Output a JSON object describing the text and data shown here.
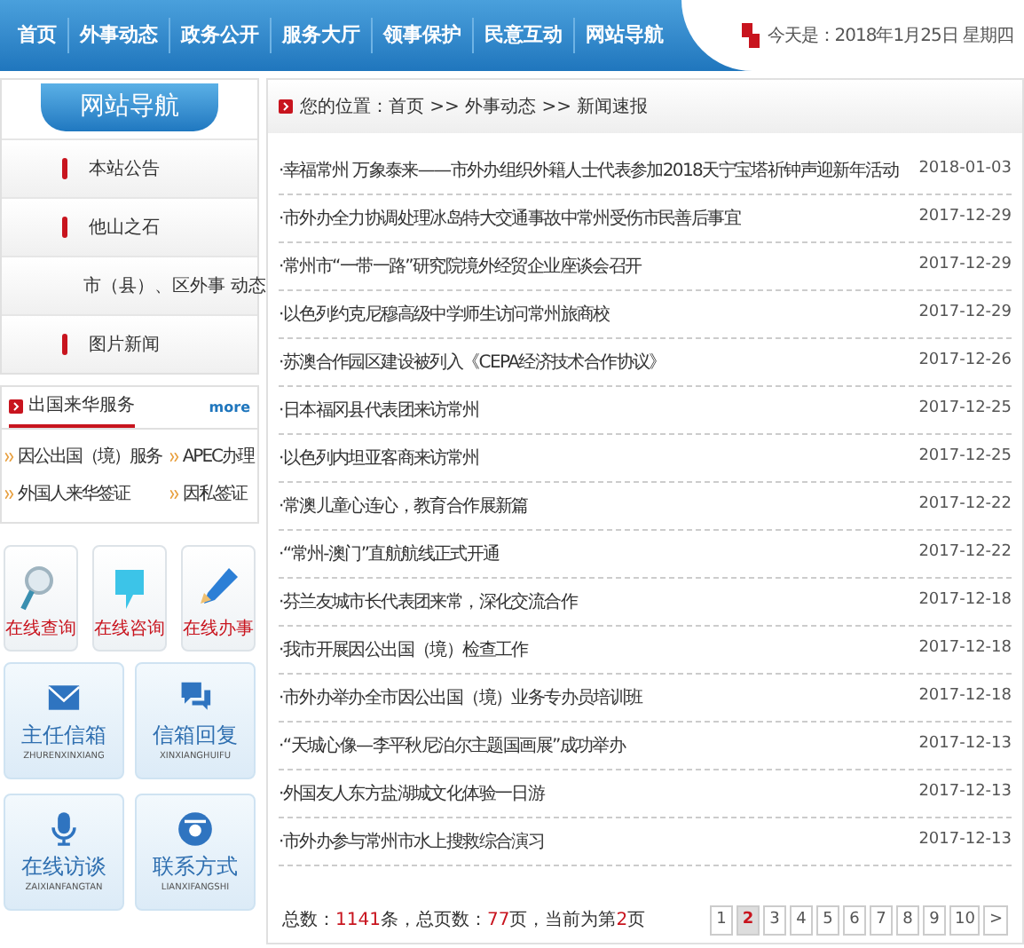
{
  "nav": [
    {
      "label": "首页"
    },
    {
      "label": "外事动态"
    },
    {
      "label": "政务公开"
    },
    {
      "label": "服务大厅"
    },
    {
      "label": "领事保护"
    },
    {
      "label": "民意互动"
    },
    {
      "label": "网站导航"
    }
  ],
  "date": "今天是：2018年1月25日 星期四",
  "sidebar": {
    "title": "网站导航",
    "items": [
      "本站公告",
      "他山之石",
      "市（县）、区外事 动态",
      "图片新闻"
    ]
  },
  "services": {
    "title": "出国来华服务",
    "more": "more",
    "links": [
      "因公出国（境）服务",
      "APEC办理",
      "外国人来华签证",
      "因私签证"
    ]
  },
  "quick": [
    {
      "label": "在线查询",
      "kind": "search"
    },
    {
      "label": "在线咨询",
      "kind": "bubble"
    },
    {
      "label": "在线办事",
      "kind": "pencil"
    }
  ],
  "tiles": [
    {
      "label": "主任信箱",
      "sub": "ZHURENXINXIANG",
      "kind": "mail"
    },
    {
      "label": "信箱回复",
      "sub": "XINXIANGHUIFU",
      "kind": "chat"
    },
    {
      "label": "在线访谈",
      "sub": "ZAIXIANFANGTAN",
      "kind": "mic"
    },
    {
      "label": "联系方式",
      "sub": "LIANXIFANGSHI",
      "kind": "phone"
    }
  ],
  "breadcrumb": "您的位置：首页 >> 外事动态 >> 新闻速报",
  "news": [
    {
      "title": "·幸福常州 万象泰来——市外办组织外籍人士代表参加2018天宁宝塔祈钟声迎新年活动",
      "date": "2018-01-03"
    },
    {
      "title": "·市外办全力协调处理冰岛特大交通事故中常州受伤市民善后事宜",
      "date": "2017-12-29"
    },
    {
      "title": "·常州市“一带一路”研究院境外经贸企业座谈会召开",
      "date": "2017-12-29"
    },
    {
      "title": "·以色列约克尼穆高级中学师生访问常州旅商校",
      "date": "2017-12-29"
    },
    {
      "title": "·苏澳合作园区建设被列入《CEPA经济技术合作协议》",
      "date": "2017-12-26"
    },
    {
      "title": "·日本福冈县代表团来访常州",
      "date": "2017-12-25"
    },
    {
      "title": "·以色列内坦亚客商来访常州",
      "date": "2017-12-25"
    },
    {
      "title": "·常澳儿童心连心，教育合作展新篇",
      "date": "2017-12-22"
    },
    {
      "title": "·“常州-澳门”直航航线正式开通",
      "date": "2017-12-22"
    },
    {
      "title": "·芬兰友城市长代表团来常，深化交流合作",
      "date": "2017-12-18"
    },
    {
      "title": "·我市开展因公出国（境）检查工作",
      "date": "2017-12-18"
    },
    {
      "title": "·市外办举办全市因公出国（境）业务专办员培训班",
      "date": "2017-12-18"
    },
    {
      "title": "·“天城心像—李平秋尼泊尔主题国画展”成功举办",
      "date": "2017-12-13"
    },
    {
      "title": "·外国友人东方盐湖城文化体验一日游",
      "date": "2017-12-13"
    },
    {
      "title": "·市外办参与常州市水上搜救综合演习",
      "date": "2017-12-13"
    }
  ],
  "summary": [
    {
      "text": "总数：",
      "highlight": false
    },
    {
      "text": "1141",
      "highlight": true
    },
    {
      "text": "条，总页数：",
      "highlight": false
    },
    {
      "text": "77",
      "highlight": true
    },
    {
      "text": "页，当前为第",
      "highlight": false
    },
    {
      "text": "2",
      "highlight": true
    },
    {
      "text": "页",
      "highlight": false
    }
  ],
  "pages": [
    {
      "label": "1",
      "selected": false
    },
    {
      "label": "2",
      "selected": true
    },
    {
      "label": "3",
      "selected": false
    },
    {
      "label": "4",
      "selected": false
    },
    {
      "label": "5",
      "selected": false
    },
    {
      "label": "6",
      "selected": false
    },
    {
      "label": "7",
      "selected": false
    },
    {
      "label": "8",
      "selected": false
    },
    {
      "label": "9",
      "selected": false
    },
    {
      "label": "10",
      "selected": false
    },
    {
      "label": ">",
      "selected": false
    }
  ]
}
